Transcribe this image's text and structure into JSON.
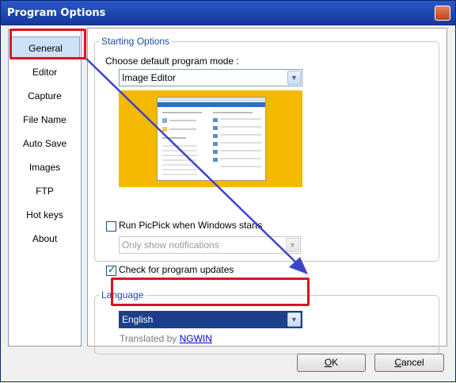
{
  "window": {
    "title": "Program Options",
    "close_glyph": "✕"
  },
  "sidebar": {
    "items": [
      {
        "label": "General",
        "selected": true
      },
      {
        "label": "Editor"
      },
      {
        "label": "Capture"
      },
      {
        "label": "File Name"
      },
      {
        "label": "Auto Save"
      },
      {
        "label": "Images"
      },
      {
        "label": "FTP"
      },
      {
        "label": "Hot keys"
      },
      {
        "label": "About"
      }
    ]
  },
  "starting_options": {
    "group_label": "Starting Options",
    "mode_label": "Choose default program mode :",
    "mode_value": "Image Editor",
    "run_on_startup_label": "Run PicPick when Windows starts",
    "run_on_startup_checked": false,
    "startup_mode_value": "Only show notifications",
    "check_updates_label": "Check for program updates",
    "check_updates_checked": true
  },
  "language": {
    "group_label": "Language",
    "value": "English",
    "translated_by_prefix": "Translated by",
    "translator": "NGWIN"
  },
  "buttons": {
    "ok_accel": "O",
    "ok_rest": "K",
    "cancel_accel": "C",
    "cancel_rest": "ancel"
  },
  "icons": {
    "dropdown": "▼",
    "check": "✓"
  },
  "colors": {
    "titlebar": "#1e47b0",
    "annotation_red": "#e01020",
    "annotation_arrow": "#3a45c8",
    "preview_background": "#f5b800",
    "selection": "#cde2f8",
    "group_label": "#1a4fa0",
    "link": "#0000cc"
  }
}
